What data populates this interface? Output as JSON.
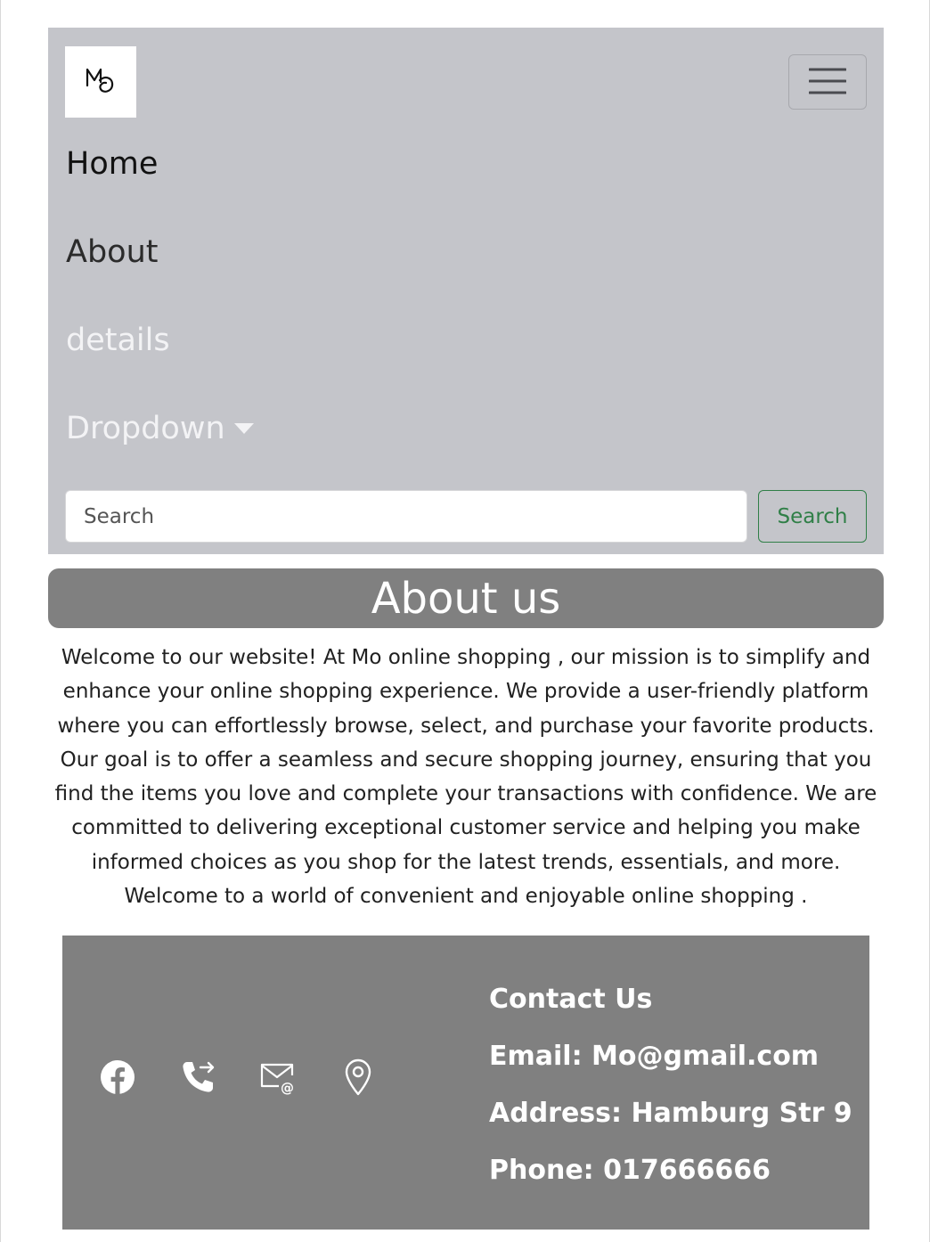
{
  "navbar": {
    "brand_icon": "mo-logo-icon",
    "toggler_icon": "hamburger-icon",
    "links": [
      {
        "label": "Home"
      },
      {
        "label": "About"
      },
      {
        "label": "details"
      },
      {
        "label": "Dropdown"
      }
    ],
    "search": {
      "placeholder": "Search",
      "button_label": "Search"
    }
  },
  "about": {
    "title": "About us",
    "text": "Welcome to our website! At Mo online shopping , our mission is to simplify and enhance your online shopping experience. We provide a user-friendly platform where you can effortlessly browse, select, and purchase your favorite products. Our goal is to offer a seamless and secure shopping journey, ensuring that you find the items you love and complete your transactions with confidence. We are committed to delivering exceptional customer service and helping you make informed choices as you shop for the latest trends, essentials, and more. Welcome to a world of convenient and enjoyable online shopping ."
  },
  "footer": {
    "icons": [
      "facebook-icon",
      "phone-icon",
      "email-icon",
      "location-icon"
    ],
    "contact_title": "Contact Us",
    "email": "Email: Mo@gmail.com",
    "address": "Address: Hamburg Str 9",
    "phone": "Phone: 017666666"
  },
  "colors": {
    "navbar_bg": "#c4c5ca",
    "section_bg": "#808080",
    "success": "#2f7f47"
  }
}
